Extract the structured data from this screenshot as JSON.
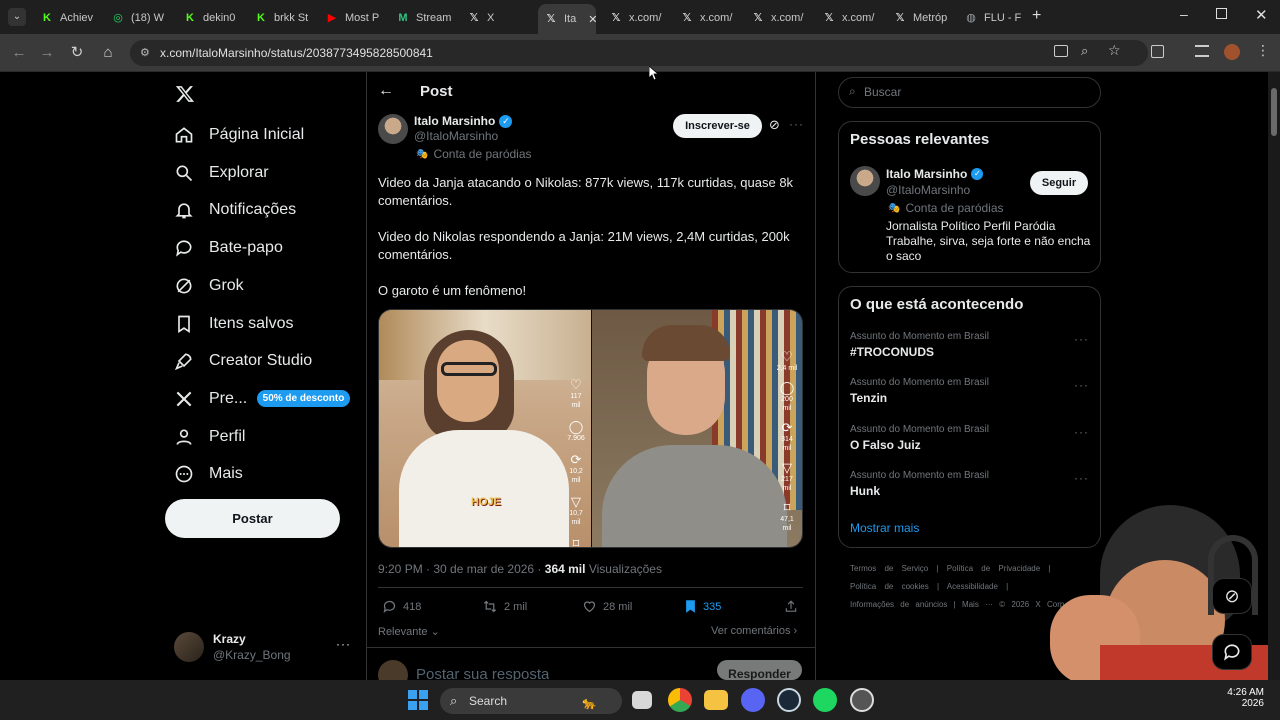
{
  "browser": {
    "tabs": [
      {
        "label": "Achiev",
        "icon": "kick-icon",
        "color": "#53fc18"
      },
      {
        "label": "(18) W",
        "icon": "whatsapp-icon",
        "color": "#25d366"
      },
      {
        "label": "dekin0",
        "icon": "kick-icon",
        "color": "#53fc18"
      },
      {
        "label": "brkk St",
        "icon": "kick-icon",
        "color": "#53fc18"
      },
      {
        "label": "Most P",
        "icon": "youtube-icon",
        "color": "#ff0000"
      },
      {
        "label": "Stream",
        "icon": "streamelements-icon",
        "color": "#33c481"
      },
      {
        "label": "X",
        "icon": "x-icon",
        "color": "#e7e9ea"
      },
      {
        "label": "Ita",
        "icon": "x-icon",
        "color": "#e7e9ea"
      },
      {
        "label": "x.com/",
        "icon": "x-icon",
        "color": "#e7e9ea"
      },
      {
        "label": "x.com/",
        "icon": "x-icon",
        "color": "#e7e9ea"
      },
      {
        "label": "x.com/",
        "icon": "x-icon",
        "color": "#e7e9ea"
      },
      {
        "label": "x.com/",
        "icon": "x-icon",
        "color": "#e7e9ea"
      },
      {
        "label": "Metróp",
        "icon": "x-icon",
        "color": "#e7e9ea"
      },
      {
        "label": "FLU - F",
        "icon": "globe-icon",
        "color": "#9aa0a6"
      }
    ],
    "url": "x.com/ItaloMarsinho/status/2038773495828500841"
  },
  "sidebar": {
    "items": [
      {
        "label": "Página Inicial",
        "icon": "home-icon"
      },
      {
        "label": "Explorar",
        "icon": "search-icon"
      },
      {
        "label": "Notificações",
        "icon": "bell-icon"
      },
      {
        "label": "Bate-papo",
        "icon": "chat-icon"
      },
      {
        "label": "Grok",
        "icon": "grok-icon"
      },
      {
        "label": "Itens salvos",
        "icon": "bookmark-icon"
      },
      {
        "label": "Creator Studio",
        "icon": "rocket-icon"
      },
      {
        "label": "Pre...",
        "icon": "x-premium-icon"
      },
      {
        "label": "Perfil",
        "icon": "person-icon"
      },
      {
        "label": "Mais",
        "icon": "more-circle-icon"
      }
    ],
    "premium_badge": "50% de desconto",
    "post_button": "Postar",
    "account": {
      "name": "Krazy",
      "handle": "@Krazy_Bong"
    }
  },
  "post": {
    "header_title": "Post",
    "author_name": "Italo Marsinho",
    "author_handle": "@ItaloMarsinho",
    "parody_label": "Conta de paródias",
    "subscribe_button": "Inscrever-se",
    "paragraphs": [
      "Video da Janja atacando o Nikolas:  877k views, 117k curtidas, quase 8k comentários.",
      "Video do Nikolas respondendo a Janja: 21M views, 2,4M curtidas, 200k comentários.",
      "O garoto é um fenômeno!"
    ],
    "media_left": {
      "caption": "HOJE",
      "counts": [
        "117 mil",
        "7.906",
        "10,2 mil",
        "10,7 mil"
      ]
    },
    "media_right": {
      "counts": [
        "2,4 mil",
        "200 mil",
        "314 mil",
        "217 mil",
        "47,1 mil"
      ]
    },
    "timestamp": "9:20 PM · 30 de mar de 2026 · ",
    "views_count": "364 mil",
    "views_label": "Visualizações",
    "replies": "418",
    "reposts": "2 mil",
    "likes": "28 mil",
    "bookmarks": "335",
    "sort_label": "Relevante",
    "see_comments": "Ver comentários",
    "reply_placeholder": "Postar sua resposta",
    "reply_button": "Responder"
  },
  "right": {
    "search_placeholder": "Buscar",
    "relevant_title": "Pessoas relevantes",
    "relevant_person": {
      "name": "Italo Marsinho",
      "handle": "@ItaloMarsinho",
      "parody": "Conta de paródias",
      "bio": "Jornalista Político Perfil Paródia Trabalhe, sirva, seja forte e não encha o saco",
      "follow_button": "Seguir"
    },
    "trends_title": "O que está acontecendo",
    "trends": [
      {
        "category": "Assunto do Momento em Brasil",
        "name": "#TROCONUDS"
      },
      {
        "category": "Assunto do Momento em Brasil",
        "name": "Tenzin"
      },
      {
        "category": "Assunto do Momento em Brasil",
        "name": "O Falso Juiz"
      },
      {
        "category": "Assunto do Momento em Brasil",
        "name": "Hunk"
      }
    ],
    "show_more": "Mostrar mais",
    "footer_row1": [
      "Termos de Serviço",
      "|",
      "Política de Privacidade",
      "|"
    ],
    "footer_row2": [
      "Política de cookies",
      "|",
      "Acessibilidade",
      "|"
    ],
    "footer_row3": [
      "Informações de anúncios",
      "|",
      "Mais ···",
      "© 2026 X Corp."
    ]
  },
  "taskbar": {
    "search_label": "Search",
    "time": "4:26 AM",
    "date": "2026"
  },
  "colors": {
    "accent": "#1d9bf0",
    "background": "#000000",
    "border": "#2f3336",
    "muted": "#71767b"
  }
}
